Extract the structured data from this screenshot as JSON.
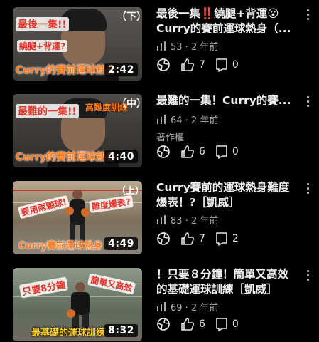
{
  "colors": {
    "background": "#000000",
    "title": "#f1f1f1",
    "meta": "#aaaaaa",
    "thumb_overlay_red": "#e3342a",
    "thumb_overlay_orange": "#ff7a1a"
  },
  "videos": [
    {
      "title": "最後一集‼️繞腿+背運😮 Curry的賽前運球熱身（...",
      "views": "53",
      "age": "2 年前",
      "extra": "",
      "likes": "7",
      "comments": "0",
      "duration": "2:42",
      "thumb_texts": [
        "最後一集!!",
        "繞腿+背運?",
        "Curry的賽前運球熱身",
        "（下）"
      ]
    },
    {
      "title": "最難的一集！Curry的賽...",
      "views": "64",
      "age": "2 年前",
      "extra": "著作權",
      "likes": "6",
      "comments": "0",
      "duration": "4:40",
      "thumb_texts": [
        "最難的一集!!",
        "高難度訓練",
        "Curry的賽前運球熱身",
        "（中）"
      ]
    },
    {
      "title": "Curry賽前的運球熱身難度爆表！?［凱威］",
      "views": "83",
      "age": "2 年前",
      "extra": "",
      "likes": "7",
      "comments": "2",
      "duration": "4:49",
      "thumb_texts": [
        "要用兩顆球!",
        "難度爆表?",
        "Curry賽前運球熱身",
        "（上）"
      ]
    },
    {
      "title": "！只要８分鐘！簡單又高效的基礎運球訓練［凱威］",
      "views": "69",
      "age": "2 年前",
      "extra": "",
      "likes": "6",
      "comments": "0",
      "duration": "8:32",
      "thumb_texts": [
        "只要8分鐘",
        "簡單又高效",
        "最基礎的運球訓練"
      ]
    }
  ]
}
